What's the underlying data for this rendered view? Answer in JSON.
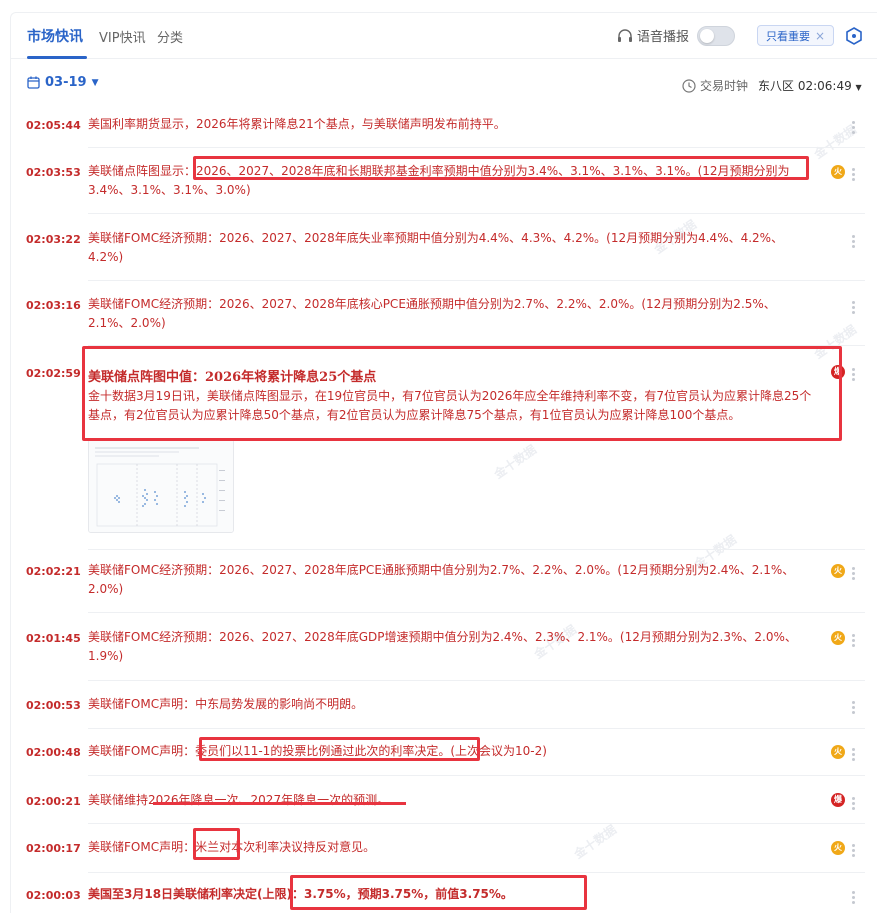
{
  "tabs": [
    {
      "label": "市场快讯",
      "active": true
    },
    {
      "label": "VIP快讯",
      "active": false
    },
    {
      "label": "分类",
      "active": false
    }
  ],
  "voice_label": "语音播报",
  "filter_chip": "只看重要",
  "date_label": "03-19",
  "trading_clock_label": "交易时钟",
  "timezone_time": "东八区 02:06:49",
  "watermark": "金十数据",
  "badges": {
    "fire": "火",
    "boom": "爆"
  },
  "items": [
    {
      "time": "02:05:44",
      "text": "美国利率期货显示，2026年将累计降息21个基点，与美联储声明发布前持平。"
    },
    {
      "time": "02:03:53",
      "text": "美联储点阵图显示：2026、2027、2028年底和长期联邦基金利率预期中值分别为3.4%、3.1%、3.1%、3.1%。(12月预期分别为3.4%、3.1%、3.1%、3.0%)"
    },
    {
      "time": "02:03:22",
      "text": "美联储FOMC经济预期：2026、2027、2028年底失业率预期中值分别为4.4%、4.3%、4.2%。(12月预期分别为4.4%、4.2%、4.2%)"
    },
    {
      "time": "02:03:16",
      "text": "美联储FOMC经济预期：2026、2027、2028年底核心PCE通胀预期中值分别为2.7%、2.2%、2.0%。(12月预期分别为2.5%、2.1%、2.0%)"
    },
    {
      "time": "02:02:59",
      "headline": "美联储点阵图中值：2026年将累计降息25个基点",
      "text": "金十数据3月19日讯，美联储点阵图显示，在19位官员中，有7位官员认为2026年应全年维持利率不变，有7位官员认为应累计降息25个基点，有2位官员认为应累计降息50个基点，有2位官员认为应累计降息75个基点，有1位官员认为应累计降息100个基点。"
    },
    {
      "time": "02:02:21",
      "text": "美联储FOMC经济预期：2026、2027、2028年底PCE通胀预期中值分别为2.7%、2.2%、2.0%。(12月预期分别为2.4%、2.1%、2.0%)"
    },
    {
      "time": "02:01:45",
      "text": "美联储FOMC经济预期：2026、2027、2028年底GDP增速预期中值分别为2.4%、2.3%、2.1%。(12月预期分别为2.3%、2.0%、1.9%)"
    },
    {
      "time": "02:00:53",
      "text": "美联储FOMC声明：中东局势发展的影响尚不明朗。"
    },
    {
      "time": "02:00:48",
      "text": "美联储FOMC声明：委员们以11-1的投票比例通过此次的利率决定。(上次会议为10-2)"
    },
    {
      "time": "02:00:21",
      "text": "美联储维持2026年降息一次、2027年降息一次的预测。"
    },
    {
      "time": "02:00:17",
      "text": "美联储FOMC声明：米兰对本次利率决议持反对意见。"
    },
    {
      "time": "02:00:03",
      "text": "美国至3月18日美联储利率决定(上限)：3.75%，预期3.75%，前值3.75%。"
    }
  ]
}
